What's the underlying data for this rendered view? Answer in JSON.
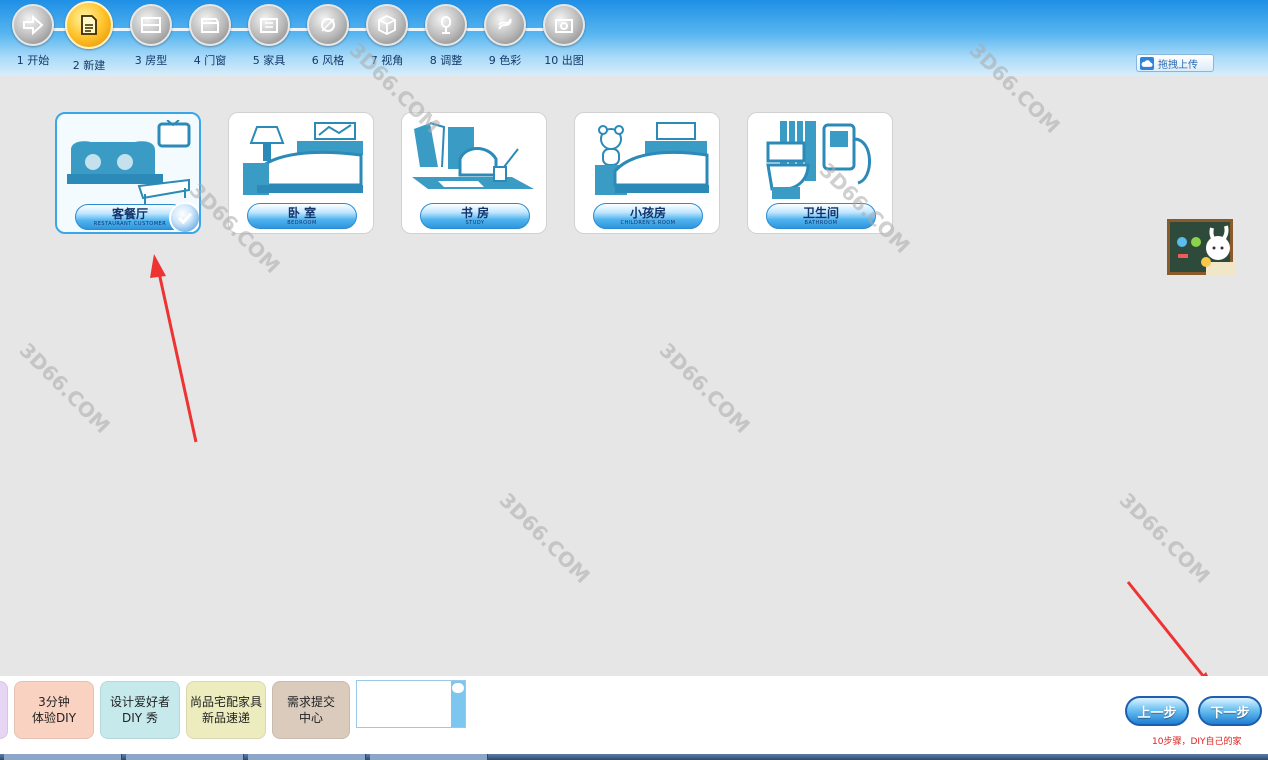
{
  "steps": [
    {
      "label": "1 开始",
      "icon": "arrow-right-icon"
    },
    {
      "label": "2 新建",
      "icon": "new-document-icon",
      "active": true
    },
    {
      "label": "3 房型",
      "icon": "floorplan-icon"
    },
    {
      "label": "4 门窗",
      "icon": "window-icon"
    },
    {
      "label": "5 家具",
      "icon": "furniture-icon"
    },
    {
      "label": "6 风格",
      "icon": "style-icon"
    },
    {
      "label": "7 视角",
      "icon": "cube-icon"
    },
    {
      "label": "8 调整",
      "icon": "adjust-icon"
    },
    {
      "label": "9 色彩",
      "icon": "color-icon"
    },
    {
      "label": "10 出图",
      "icon": "camera-icon"
    }
  ],
  "upload": {
    "label": "拖拽上传"
  },
  "rooms": [
    {
      "cn": "客餐厅",
      "en": "RESTAURANT CUSTOMER",
      "selected": true
    },
    {
      "cn": "卧 室",
      "en": "BEDROOM"
    },
    {
      "cn": "书 房",
      "en": "STUDY"
    },
    {
      "cn": "小孩房",
      "en": "CHILDREN'S ROOM"
    },
    {
      "cn": "卫生间",
      "en": "BATHROOM"
    }
  ],
  "bottom": {
    "features": [
      {
        "label": "3分钟\n体验DIY",
        "color": "#f9d2c2"
      },
      {
        "label": "设计爱好者\nDIY 秀",
        "color": "#c6e9ec"
      },
      {
        "label": "尚品宅配家具\n新品速递",
        "color": "#ececbe"
      },
      {
        "label": "需求提交\n中心",
        "color": "#dacbbd"
      }
    ],
    "prev": "上一步",
    "next": "下一步",
    "tip": "10步骤，DIY自己的家"
  },
  "watermark": "3D66.COM",
  "colors": {
    "accent": "#2f96dc",
    "arrow": "#ee3333"
  }
}
